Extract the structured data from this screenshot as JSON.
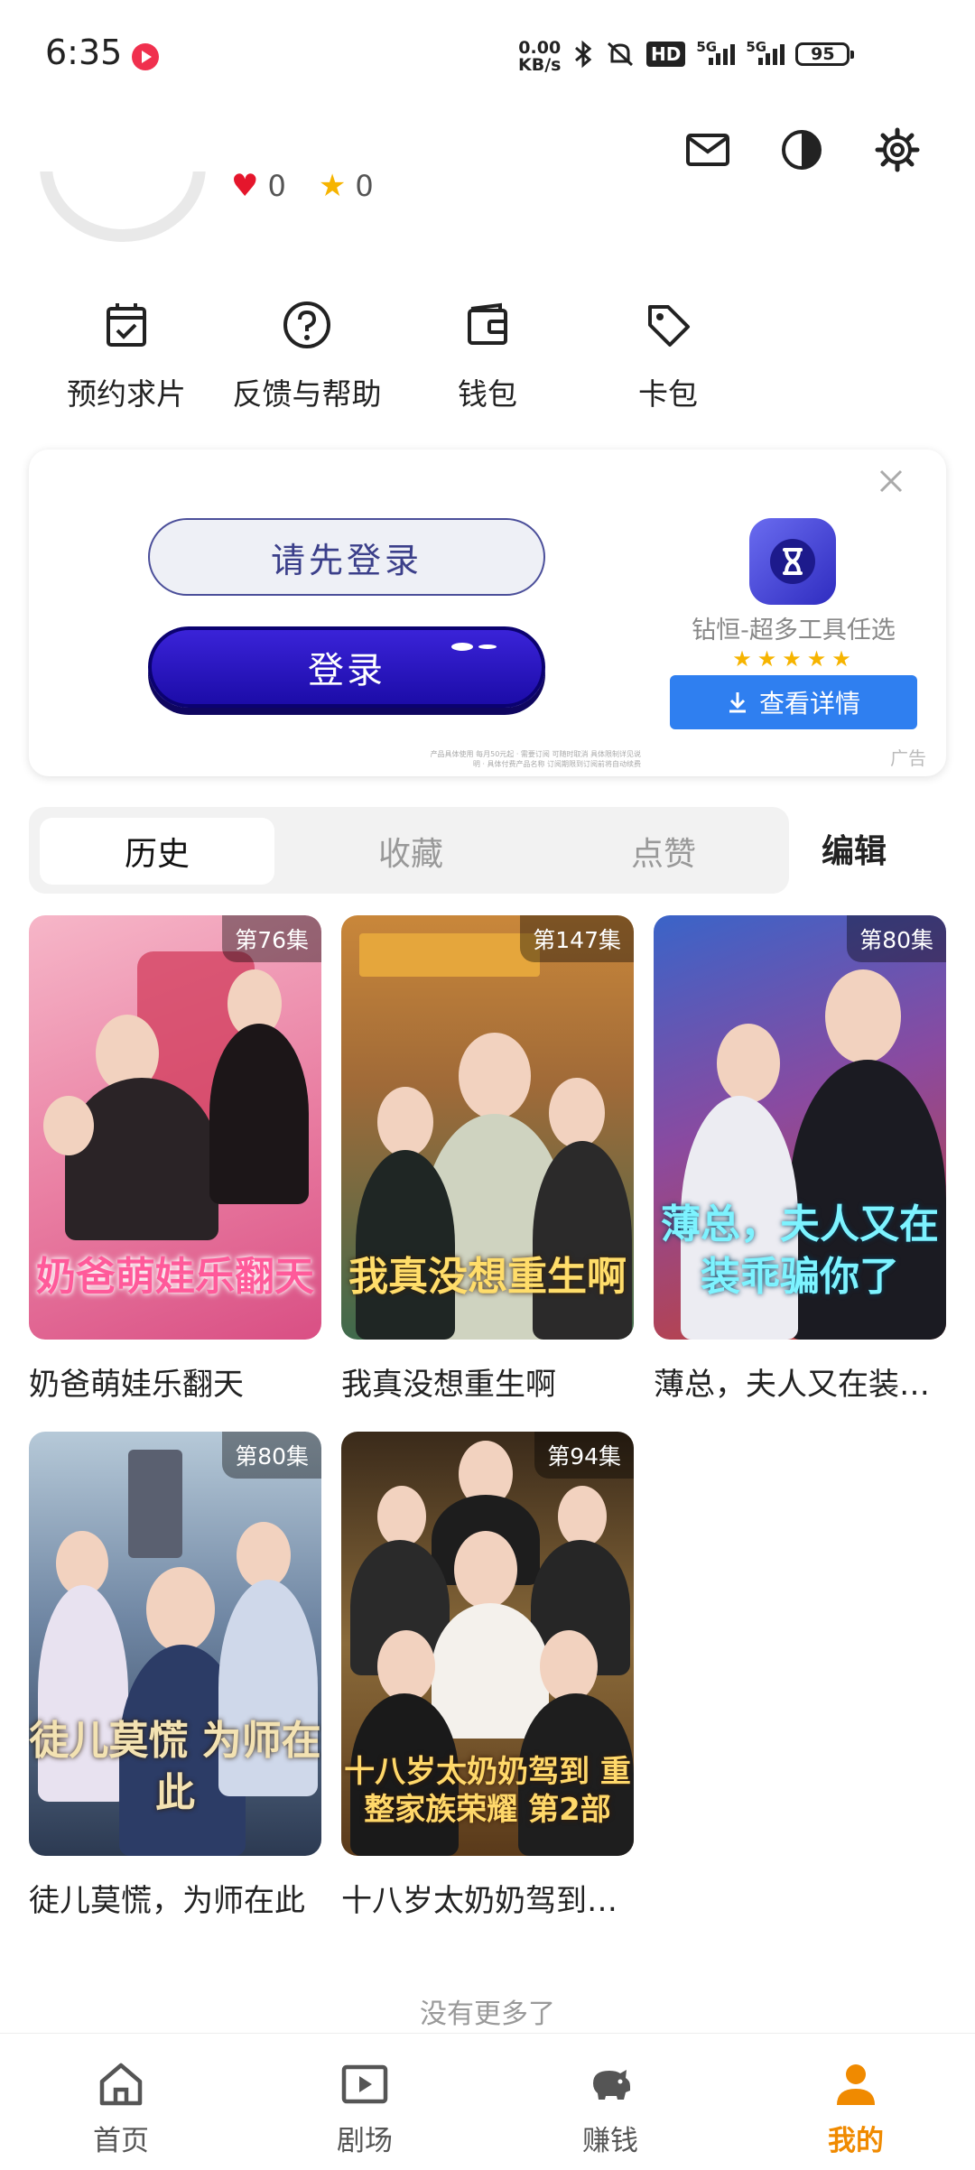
{
  "status_bar": {
    "time": "6:35",
    "speed_value": "0.00",
    "speed_unit": "KB/s",
    "hd": "HD",
    "net1": "5G",
    "net2": "5G",
    "battery": "95"
  },
  "profile": {
    "likes": "0",
    "stars": "0"
  },
  "quick_actions": [
    {
      "label": "预约求片",
      "icon": "calendar-check-icon"
    },
    {
      "label": "反馈与帮助",
      "icon": "help-circle-icon"
    },
    {
      "label": "钱包",
      "icon": "wallet-icon"
    },
    {
      "label": "卡包",
      "icon": "tag-icon"
    }
  ],
  "ad": {
    "input_text": "请先登录",
    "login_button": "登录",
    "app_name": "钻恒-超多工具任选",
    "stars": "★★★★★",
    "detail_button": "查看详情",
    "tag": "广告",
    "fine_print": "产品具体使用 每月50元起 · 需要订阅 可随时取消 具体限制详见说明 · 具体付费产品名称 订阅期限到订阅前将自动续费"
  },
  "tabs": {
    "history": "历史",
    "favorites": "收藏",
    "likes": "点赞",
    "edit": "编辑"
  },
  "history_items": [
    {
      "title": "奶爸萌娃乐翻天",
      "episodes": "第76集",
      "poster_text": "奶爸萌娃乐翻天"
    },
    {
      "title": "我真没想重生啊",
      "episodes": "第147集",
      "poster_text": "我真没想重生啊"
    },
    {
      "title": "薄总，夫人又在装…",
      "episodes": "第80集",
      "poster_text": "薄总，夫人又在装乖骗你了"
    },
    {
      "title": "徒儿莫慌，为师在此",
      "episodes": "第80集",
      "poster_text": "徒儿莫慌 为师在此"
    },
    {
      "title": "十八岁太奶奶驾到…",
      "episodes": "第94集",
      "poster_text": "十八岁太奶奶驾到 重整家族荣耀 第2部"
    }
  ],
  "footer_text": "没有更多了",
  "bottom_nav": [
    {
      "label": "首页",
      "icon": "home-icon"
    },
    {
      "label": "剧场",
      "icon": "play-icon"
    },
    {
      "label": "赚钱",
      "icon": "piggy-bank-icon"
    },
    {
      "label": "我的",
      "icon": "person-icon",
      "active": true
    }
  ],
  "colors": {
    "accent": "#f08a00",
    "ad_button": "#2f7ff0",
    "ad_login": "#2414c0"
  }
}
